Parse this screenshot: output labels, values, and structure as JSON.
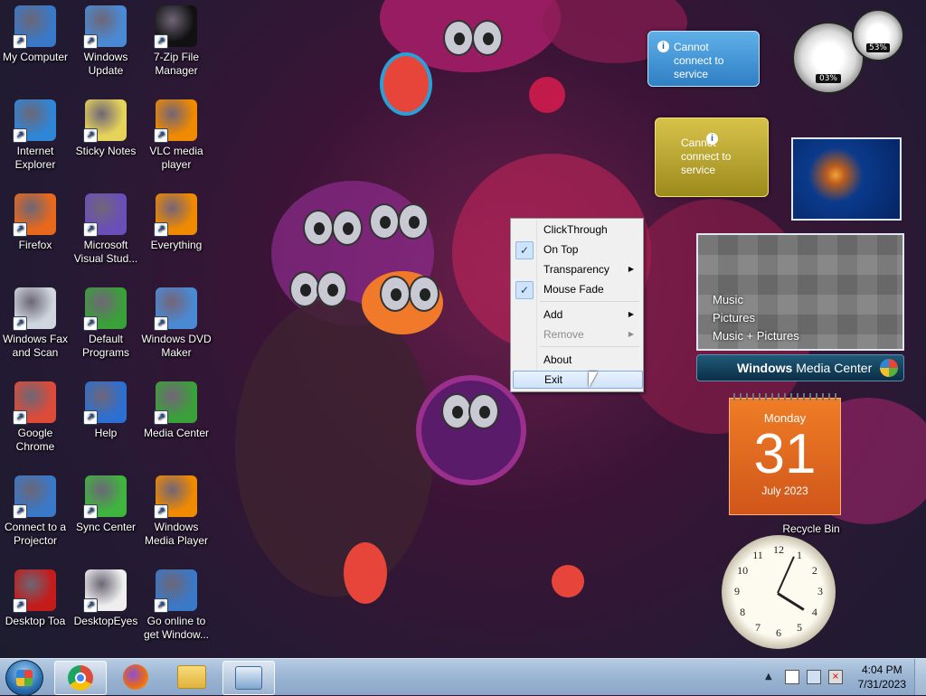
{
  "desktop_icons": [
    {
      "label": "My Computer",
      "icon": "computer-icon",
      "color": "#3a78c8"
    },
    {
      "label": "Windows Update",
      "icon": "windows-update-icon",
      "color": "#4a8ad4"
    },
    {
      "label": "7-Zip File Manager",
      "icon": "7zip-icon",
      "color": "#111111"
    },
    {
      "label": "Internet Explorer",
      "icon": "ie-icon",
      "color": "#2f86d6"
    },
    {
      "label": "Sticky Notes",
      "icon": "sticky-notes-icon",
      "color": "#e6d35a"
    },
    {
      "label": "VLC media player",
      "icon": "vlc-icon",
      "color": "#f08a00"
    },
    {
      "label": "Firefox",
      "icon": "firefox-icon",
      "color": "#e8681c"
    },
    {
      "label": "Microsoft Visual Stud...",
      "icon": "visual-studio-icon",
      "color": "#6a4fb8"
    },
    {
      "label": "Everything",
      "icon": "everything-icon",
      "color": "#f08a00"
    },
    {
      "label": "Windows Fax and Scan",
      "icon": "fax-icon",
      "color": "#cfd6de"
    },
    {
      "label": "Default Programs",
      "icon": "default-programs-icon",
      "color": "#3aa03a"
    },
    {
      "label": "Windows DVD Maker",
      "icon": "dvd-maker-icon",
      "color": "#4a8ad4"
    },
    {
      "label": "Google Chrome",
      "icon": "chrome-icon",
      "color": "#dd4b39"
    },
    {
      "label": "Help",
      "icon": "help-icon",
      "color": "#2c6fd0"
    },
    {
      "label": "Media Center",
      "icon": "media-center-icon",
      "color": "#3aa03a"
    },
    {
      "label": "Connect to a Projector",
      "icon": "projector-icon",
      "color": "#3a78c8"
    },
    {
      "label": "Sync Center",
      "icon": "sync-icon",
      "color": "#3fb53f"
    },
    {
      "label": "Windows Media Player",
      "icon": "media-player-icon",
      "color": "#f08a00"
    },
    {
      "label": "Desktop Toa",
      "icon": "desktop-toa-icon",
      "color": "#c41b1b"
    },
    {
      "label": "DesktopEyes",
      "icon": "desktop-eyes-icon",
      "color": "#eeeeee"
    },
    {
      "label": "Go online to get Window...",
      "icon": "windows-logo-icon",
      "color": "#3a78c8"
    }
  ],
  "gadgets": {
    "feed_message": "Cannot connect to service",
    "weather_message": "Cannot connect to service",
    "cpu_meter": {
      "cpu": "03%",
      "memory": "53%"
    },
    "media_center": {
      "items": [
        "Music",
        "Pictures",
        "Music + Pictures"
      ],
      "brand_prefix": "Windows",
      "brand_suffix": "Media Center"
    },
    "calendar": {
      "weekday": "Monday",
      "day": "31",
      "month_year": "July 2023"
    },
    "clock": {
      "numbers": [
        "12",
        "1",
        "2",
        "3",
        "4",
        "5",
        "6",
        "7",
        "8",
        "9",
        "10",
        "11"
      ]
    }
  },
  "recycle_bin": {
    "label": "Recycle Bin"
  },
  "context_menu": {
    "items": [
      {
        "label": "ClickThrough",
        "checked": false,
        "submenu": false,
        "disabled": false
      },
      {
        "label": "On Top",
        "checked": true,
        "submenu": false,
        "disabled": false
      },
      {
        "label": "Transparency",
        "checked": false,
        "submenu": true,
        "disabled": false
      },
      {
        "label": "Mouse Fade",
        "checked": true,
        "submenu": false,
        "disabled": false
      },
      {
        "label": "Add",
        "checked": false,
        "submenu": true,
        "disabled": false
      },
      {
        "label": "Remove",
        "checked": false,
        "submenu": true,
        "disabled": true
      },
      {
        "label": "About",
        "checked": false,
        "submenu": false,
        "disabled": false
      },
      {
        "label": "Exit",
        "checked": false,
        "submenu": false,
        "disabled": false,
        "highlighted": true
      }
    ],
    "check_glyph": "✓",
    "arrow_glyph": "▶"
  },
  "taskbar": {
    "start_icon": "windows-start-icon",
    "pinned": [
      "chrome-icon",
      "firefox-icon",
      "explorer-icon",
      "desktop-toa-taskbar-icon"
    ],
    "tray_icons": [
      "show-hidden-icons-icon",
      "action-center-icon",
      "network-icon",
      "volume-mute-icon"
    ],
    "time": "4:04 PM",
    "date": "7/31/2023"
  }
}
